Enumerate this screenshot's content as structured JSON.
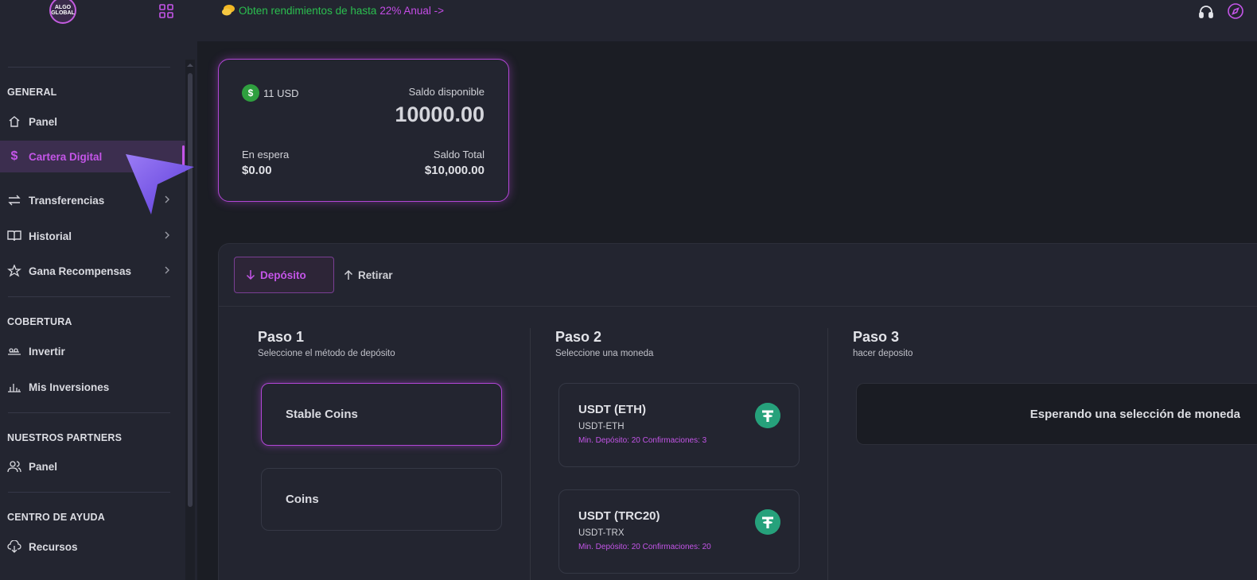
{
  "app": {
    "logo_text": "ALGO GLOBAL",
    "accent_color": "#c455e8",
    "success_color": "#2bbf4f"
  },
  "topbar": {
    "promo_text": "Obten rendimientos de hasta",
    "promo_highlight": "22% Anual ->"
  },
  "sidebar": {
    "sections": [
      {
        "title": "GENERAL"
      },
      {
        "title": "COBERTURA"
      },
      {
        "title": "NUESTROS PARTNERS"
      },
      {
        "title": "CENTRO DE AYUDA"
      }
    ],
    "items": [
      {
        "label": "Panel",
        "icon": "home-icon"
      },
      {
        "label": "Cartera Digital",
        "icon": "dollar-icon",
        "active": true
      },
      {
        "label": "Transferencias",
        "icon": "transfer-icon"
      },
      {
        "label": "Historial",
        "icon": "book-icon"
      },
      {
        "label": "Gana Recompensas",
        "icon": "star-icon"
      },
      {
        "label": "Invertir",
        "icon": "invest-icon"
      },
      {
        "label": "Mis Inversiones",
        "icon": "chart-icon"
      },
      {
        "label": "Panel",
        "icon": "users-icon"
      },
      {
        "label": "Recursos",
        "icon": "cloud-download-icon"
      }
    ]
  },
  "balance": {
    "currency_badge": "11 USD",
    "coin_symbol": "$",
    "available_label": "Saldo disponible",
    "available_amount": "10000.00",
    "pending_label": "En espera",
    "pending_amount": "$0.00",
    "total_label": "Saldo Total",
    "total_amount": "$10,000.00"
  },
  "tabs": {
    "deposit": "Depósito",
    "withdraw": "Retirar"
  },
  "steps": [
    {
      "title": "Paso 1",
      "subtitle": "Seleccione el método de depósito"
    },
    {
      "title": "Paso 2",
      "subtitle": "Seleccione una moneda"
    },
    {
      "title": "Paso 3",
      "subtitle": "hacer deposito"
    }
  ],
  "methods": [
    {
      "label": "Stable Coins",
      "selected": true
    },
    {
      "label": "Coins",
      "selected": false
    }
  ],
  "coins": [
    {
      "name": "USDT (ETH)",
      "network": "USDT-ETH",
      "meta": "Min. Depósito: 20  Confirmaciones: 3"
    },
    {
      "name": "USDT (TRC20)",
      "network": "USDT-TRX",
      "meta": "Min. Depósito: 20  Confirmaciones: 20"
    }
  ],
  "step3": {
    "waiting_text": "Esperando una selección de moneda"
  }
}
